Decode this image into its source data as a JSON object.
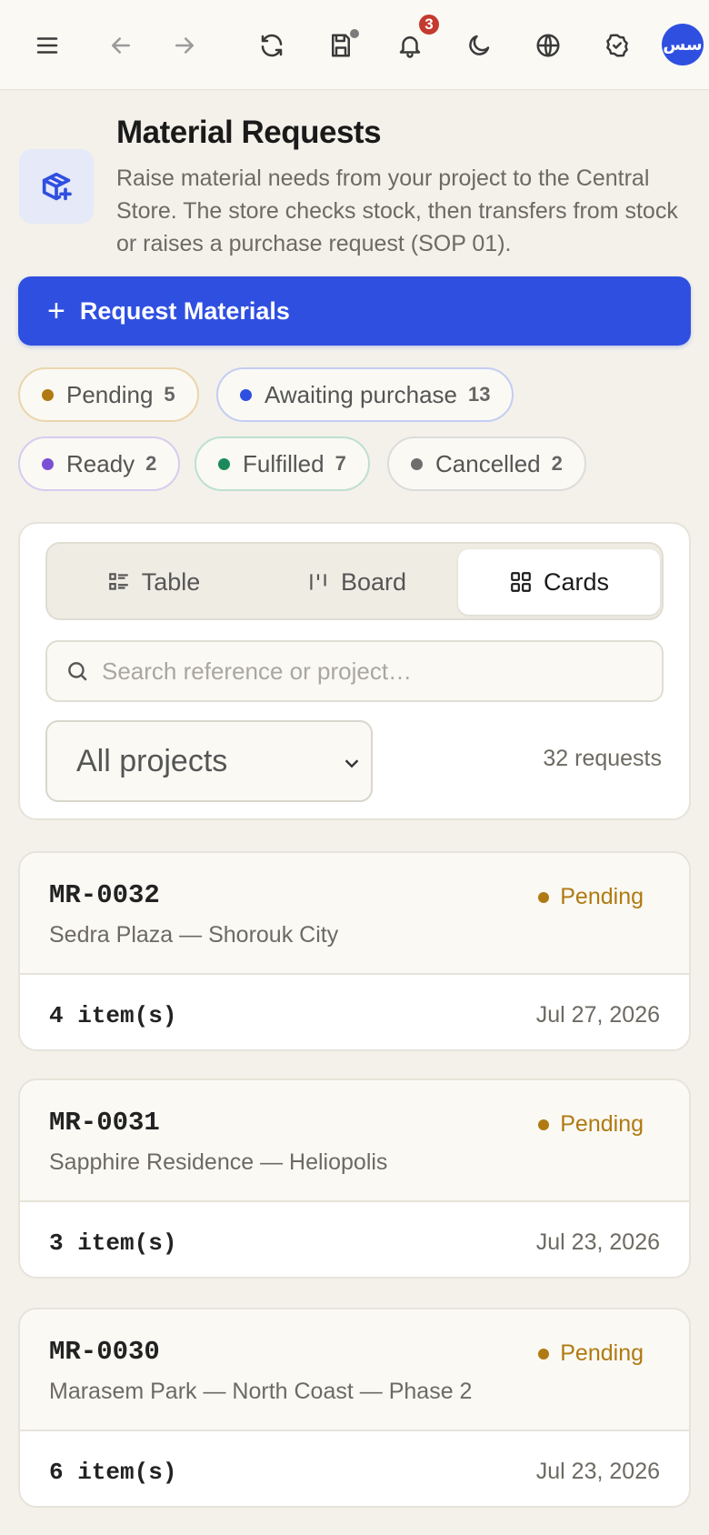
{
  "topbar": {
    "notification_count": "3",
    "avatar_initials": "سس"
  },
  "header": {
    "title": "Material Requests",
    "description": "Raise material needs from your project to the Central Store. The store checks stock, then transfers from stock or raises a purchase request (SOP 01)."
  },
  "primary_action": {
    "label": "Request Materials"
  },
  "status_chips": [
    {
      "label": "Pending",
      "count": "5",
      "color": "#b07a12",
      "border": "#ead6ad"
    },
    {
      "label": "Awaiting purchase",
      "count": "13",
      "color": "#2f4fe0",
      "border": "#c5cdf3"
    },
    {
      "label": "Ready",
      "count": "2",
      "color": "#7b4fd4",
      "border": "#d7ccef"
    },
    {
      "label": "Fulfilled",
      "count": "7",
      "color": "#1b8a5a",
      "border": "#bfe0cf"
    },
    {
      "label": "Cancelled",
      "count": "2",
      "color": "#6e6e6e",
      "border": "#dcdcdc"
    }
  ],
  "views": {
    "table": "Table",
    "board": "Board",
    "cards": "Cards",
    "active": "cards"
  },
  "search": {
    "placeholder": "Search reference or project…",
    "value": ""
  },
  "project_filter": {
    "selected": "All projects"
  },
  "request_count": "32 requests",
  "requests": [
    {
      "ref": "MR-0032",
      "project": "Sedra Plaza — Shorouk City",
      "status": "Pending",
      "items": "4 item(s)",
      "date": "Jul 27, 2026"
    },
    {
      "ref": "MR-0031",
      "project": "Sapphire Residence — Heliopolis",
      "status": "Pending",
      "items": "3 item(s)",
      "date": "Jul 23, 2026"
    },
    {
      "ref": "MR-0030",
      "project": "Marasem Park — North Coast — Phase 2",
      "status": "Pending",
      "items": "6 item(s)",
      "date": "Jul 23, 2026"
    }
  ]
}
